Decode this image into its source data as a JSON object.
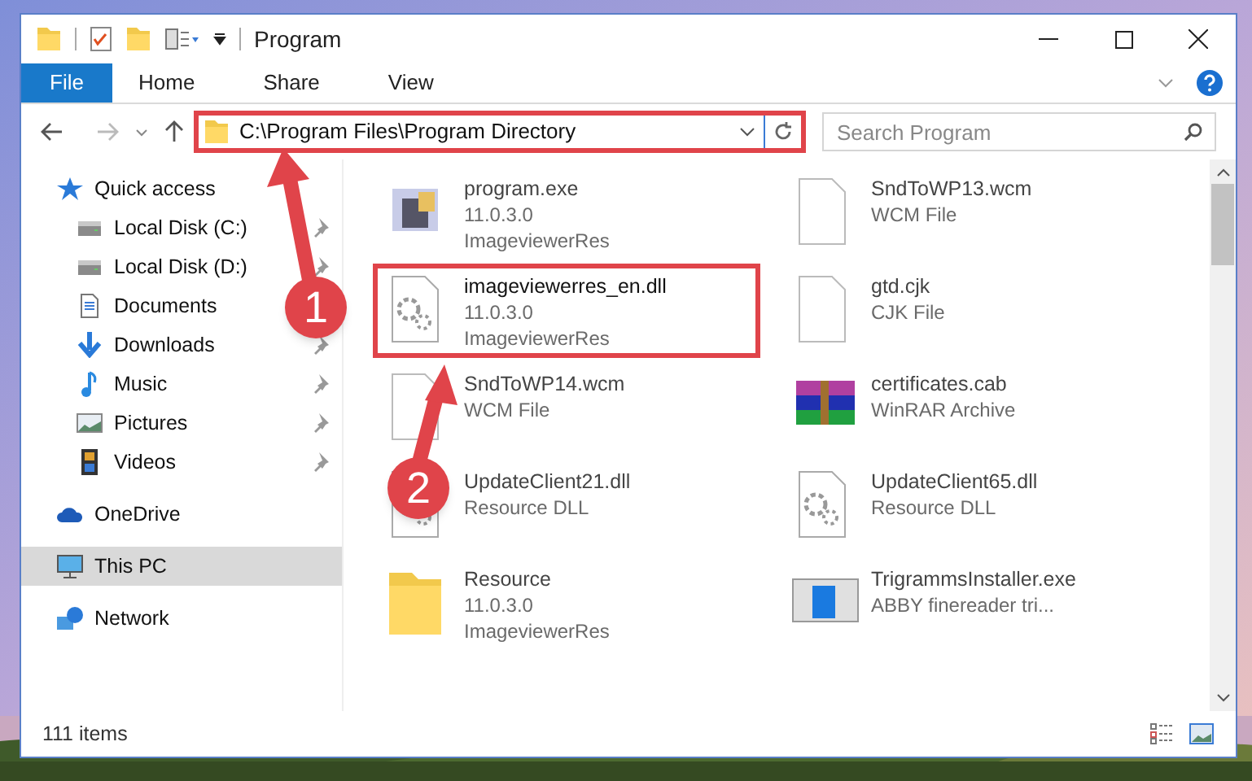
{
  "window": {
    "title": "Program"
  },
  "ribbon": {
    "tabs": [
      {
        "label": "File",
        "selected": true
      },
      {
        "label": "Home",
        "selected": false
      },
      {
        "label": "Share",
        "selected": false
      },
      {
        "label": "View",
        "selected": false
      }
    ]
  },
  "address": {
    "path": "C:\\Program Files\\Program Directory",
    "highlighted": true
  },
  "search": {
    "placeholder": "Search Program"
  },
  "sidebar": {
    "items": [
      {
        "label": "Quick access",
        "kind": "star",
        "selected": false,
        "children": [
          {
            "label": "Local Disk (C:)",
            "kind": "disk",
            "pinned": true
          },
          {
            "label": "Local Disk (D:)",
            "kind": "disk",
            "pinned": true
          },
          {
            "label": "Documents",
            "kind": "documents"
          },
          {
            "label": "Downloads",
            "kind": "downloads",
            "pinned": true
          },
          {
            "label": "Music",
            "kind": "music",
            "pinned": true
          },
          {
            "label": "Pictures",
            "kind": "pictures",
            "pinned": true
          },
          {
            "label": "Videos",
            "kind": "videos",
            "pinned": true
          }
        ]
      },
      {
        "label": "OneDrive",
        "kind": "cloud",
        "selected": false
      },
      {
        "label": "This PC",
        "kind": "pc",
        "selected": true
      },
      {
        "label": "Network",
        "kind": "network",
        "selected": false
      }
    ]
  },
  "files": [
    {
      "name": "program.exe",
      "details": [
        "11.0.3.0",
        "ImageviewerRes"
      ],
      "kind": "exe",
      "highlighted": false
    },
    {
      "name": "SndToWP13.wcm",
      "details": [
        "WCM File"
      ],
      "kind": "blank",
      "highlighted": false
    },
    {
      "name": "imageviewerres_en.dll",
      "details": [
        "11.0.3.0",
        "ImageviewerRes"
      ],
      "kind": "dll",
      "highlighted": true
    },
    {
      "name": "gtd.cjk",
      "details": [
        "CJK File"
      ],
      "kind": "blank",
      "highlighted": false
    },
    {
      "name": "SndToWP14.wcm",
      "details": [
        "WCM File"
      ],
      "kind": "blank",
      "highlighted": false
    },
    {
      "name": "certificates.cab",
      "details": [
        "WinRAR Archive"
      ],
      "kind": "archive",
      "highlighted": false
    },
    {
      "name": "UpdateClient21.dll",
      "details": [
        "Resource DLL"
      ],
      "kind": "dll",
      "highlighted": false
    },
    {
      "name": "UpdateClient65.dll",
      "details": [
        "Resource DLL"
      ],
      "kind": "dll",
      "highlighted": false
    },
    {
      "name": "Resource",
      "details": [
        "11.0.3.0",
        "ImageviewerRes"
      ],
      "kind": "folder",
      "highlighted": false
    },
    {
      "name": "TrigrammsInstaller.exe",
      "details": [
        "ABBY finereader tri..."
      ],
      "kind": "installer",
      "highlighted": false
    }
  ],
  "status_bar": {
    "text": "111 items"
  },
  "annotations": [
    {
      "label": "1"
    },
    {
      "label": "2"
    }
  ]
}
